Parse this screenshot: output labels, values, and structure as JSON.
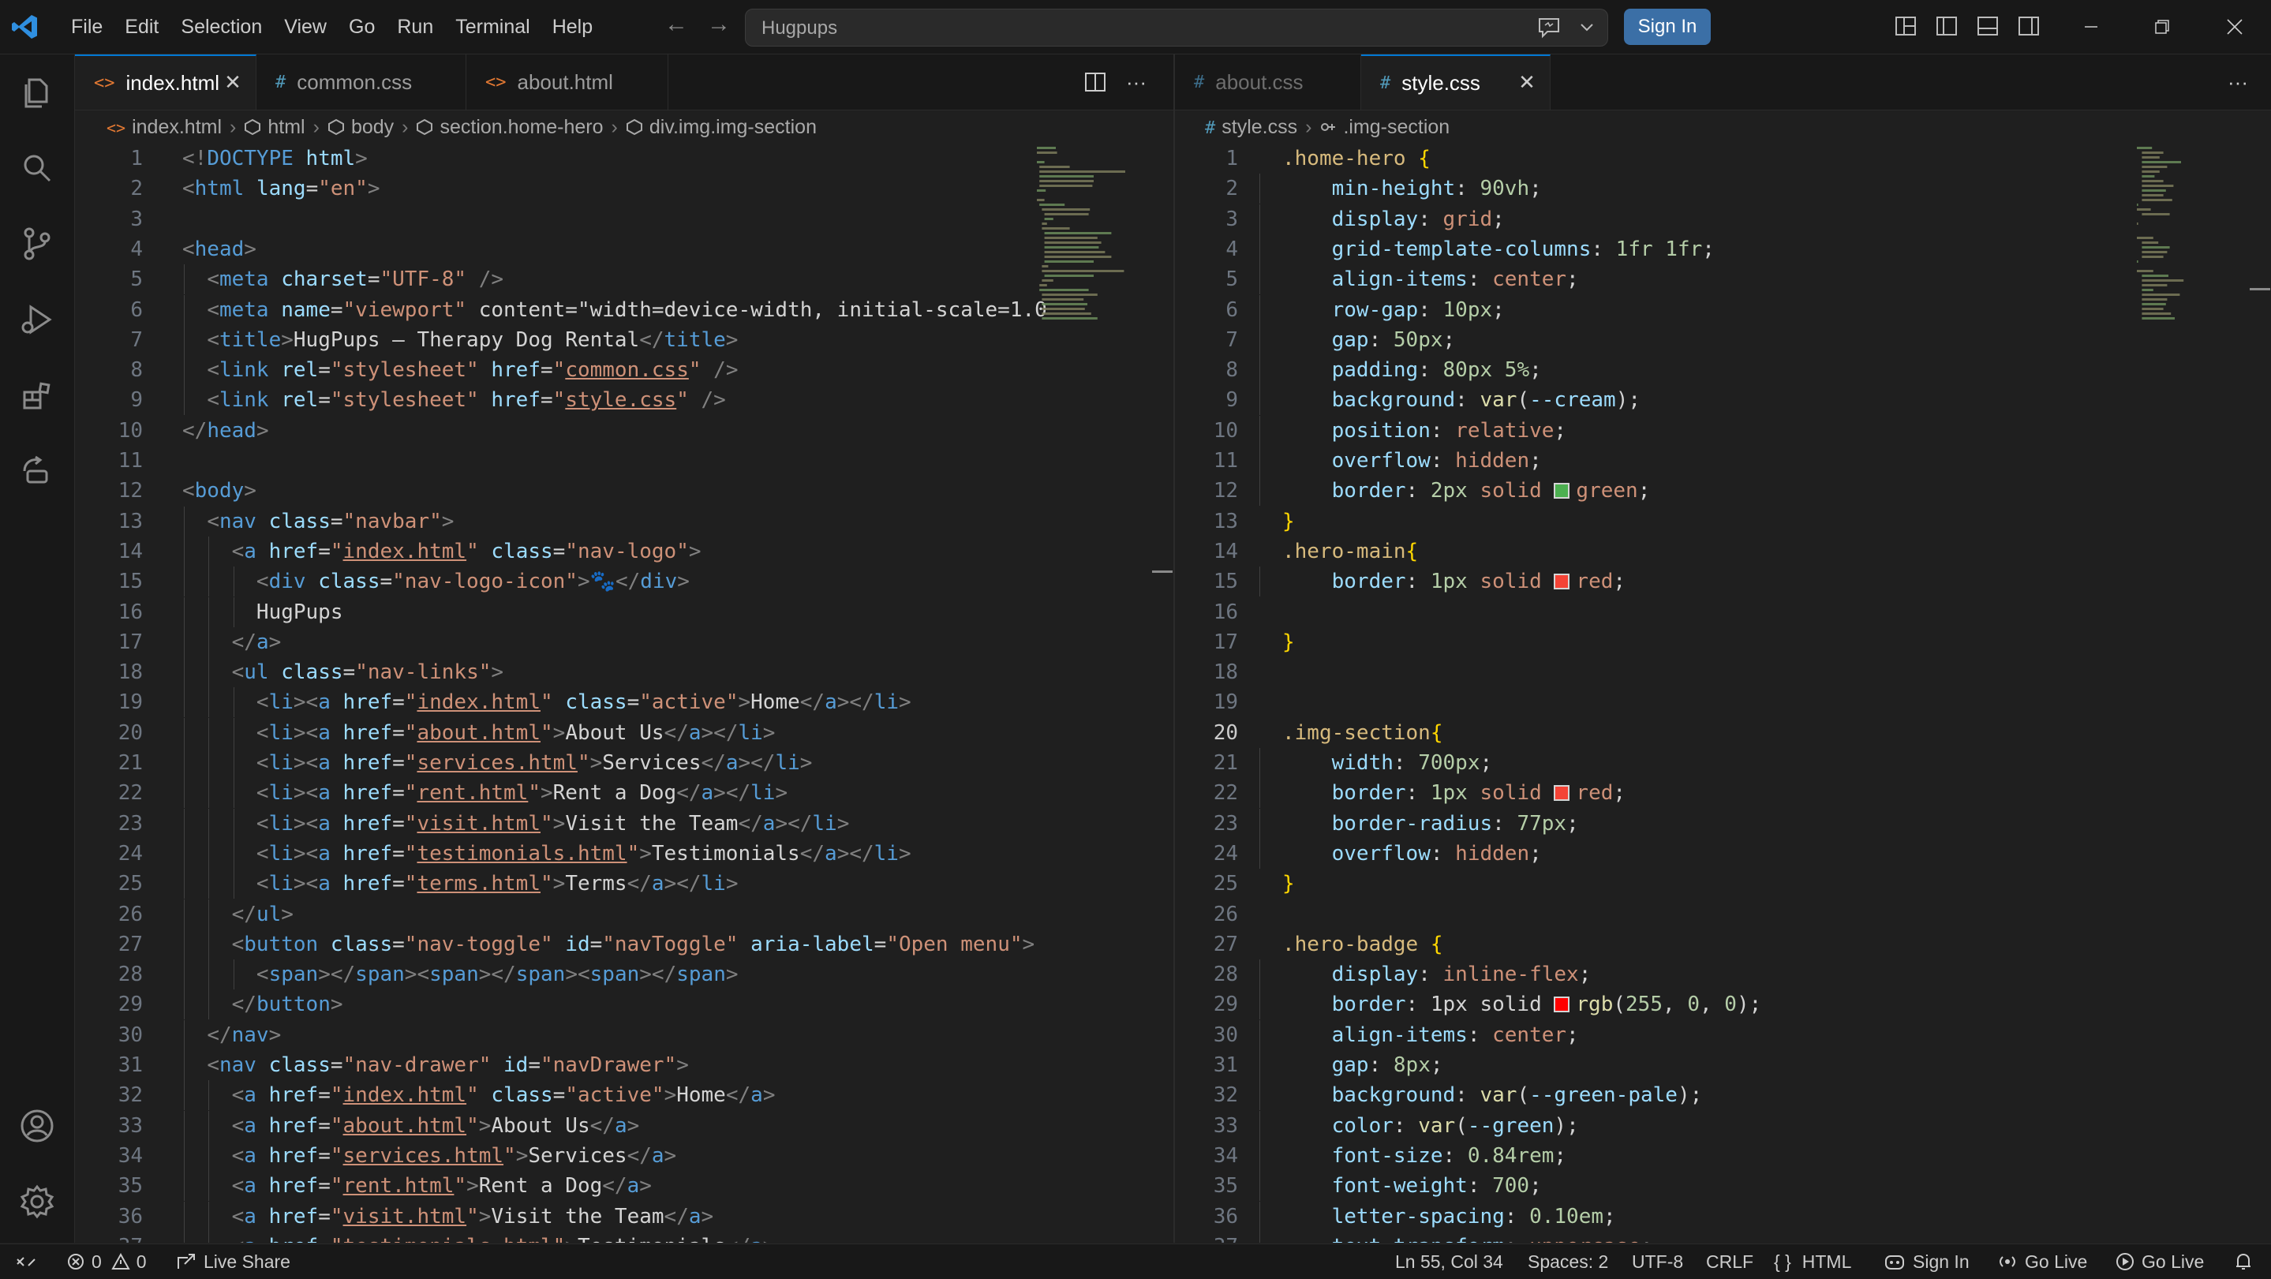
{
  "titlebar": {
    "menu": [
      "File",
      "Edit",
      "Selection",
      "View",
      "Go",
      "Run",
      "Terminal",
      "Help"
    ],
    "search_text": "Hugpups",
    "sign_in_label": "Sign In"
  },
  "activity_icons": [
    "explorer-icon",
    "search-icon",
    "source-control-icon",
    "run-debug-icon",
    "extensions-icon",
    "remote-explorer-icon",
    "accounts-icon",
    "settings-gear-icon"
  ],
  "left": {
    "tabs": [
      {
        "label": "index.html",
        "icon": "<>",
        "active": true
      },
      {
        "label": "common.css",
        "icon": "#",
        "active": false
      },
      {
        "label": "about.html",
        "icon": "<>",
        "active": false
      }
    ],
    "breadcrumb": [
      "index.html",
      "html",
      "body",
      "section.home-hero",
      "div.img.img-section"
    ],
    "lines": [
      {
        "n": "1",
        "text": "<!DOCTYPE html>"
      },
      {
        "n": "2",
        "text": "<html lang=\"en\">"
      },
      {
        "n": "3",
        "text": ""
      },
      {
        "n": "4",
        "text": "<head>"
      },
      {
        "n": "5",
        "text": "  <meta charset=\"UTF-8\" />"
      },
      {
        "n": "6",
        "text": "  <meta name=\"viewport\" content=\"width=device-width, initial-scale=1.0"
      },
      {
        "n": "7",
        "text": "  <title>HugPups — Therapy Dog Rental</title>"
      },
      {
        "n": "8",
        "text": "  <link rel=\"stylesheet\" href=\"common.css\" />"
      },
      {
        "n": "9",
        "text": "  <link rel=\"stylesheet\" href=\"style.css\" />"
      },
      {
        "n": "10",
        "text": "</head>"
      },
      {
        "n": "11",
        "text": ""
      },
      {
        "n": "12",
        "text": "<body>"
      },
      {
        "n": "13",
        "text": "  <nav class=\"navbar\">"
      },
      {
        "n": "14",
        "text": "    <a href=\"index.html\" class=\"nav-logo\">"
      },
      {
        "n": "15",
        "text": "      <div class=\"nav-logo-icon\">🐾</div>"
      },
      {
        "n": "16",
        "text": "      HugPups"
      },
      {
        "n": "17",
        "text": "    </a>"
      },
      {
        "n": "18",
        "text": "    <ul class=\"nav-links\">"
      },
      {
        "n": "19",
        "text": "      <li><a href=\"index.html\" class=\"active\">Home</a></li>"
      },
      {
        "n": "20",
        "text": "      <li><a href=\"about.html\">About Us</a></li>"
      },
      {
        "n": "21",
        "text": "      <li><a href=\"services.html\">Services</a></li>"
      },
      {
        "n": "22",
        "text": "      <li><a href=\"rent.html\">Rent a Dog</a></li>"
      },
      {
        "n": "23",
        "text": "      <li><a href=\"visit.html\">Visit the Team</a></li>"
      },
      {
        "n": "24",
        "text": "      <li><a href=\"testimonials.html\">Testimonials</a></li>"
      },
      {
        "n": "25",
        "text": "      <li><a href=\"terms.html\">Terms</a></li>"
      },
      {
        "n": "26",
        "text": "    </ul>"
      },
      {
        "n": "27",
        "text": "    <button class=\"nav-toggle\" id=\"navToggle\" aria-label=\"Open menu\">"
      },
      {
        "n": "28",
        "text": "      <span></span><span></span><span></span>"
      },
      {
        "n": "29",
        "text": "    </button>"
      },
      {
        "n": "30",
        "text": "  </nav>"
      },
      {
        "n": "31",
        "text": "  <nav class=\"nav-drawer\" id=\"navDrawer\">"
      },
      {
        "n": "32",
        "text": "    <a href=\"index.html\" class=\"active\">Home</a>"
      },
      {
        "n": "33",
        "text": "    <a href=\"about.html\">About Us</a>"
      },
      {
        "n": "34",
        "text": "    <a href=\"services.html\">Services</a>"
      },
      {
        "n": "35",
        "text": "    <a href=\"rent.html\">Rent a Dog</a>"
      },
      {
        "n": "36",
        "text": "    <a href=\"visit.html\">Visit the Team</a>"
      },
      {
        "n": "37",
        "text": "    <a href=\"testimonials.html\">Testimonials</a>"
      }
    ]
  },
  "right": {
    "tabs": [
      {
        "label": "about.css",
        "icon": "#",
        "active": false
      },
      {
        "label": "style.css",
        "icon": "#",
        "active": true
      }
    ],
    "breadcrumb": [
      "style.css",
      ".img-section"
    ],
    "current_line": "20",
    "lines": [
      {
        "n": "1",
        "text": ".home-hero {"
      },
      {
        "n": "2",
        "text": "    min-height: 90vh;"
      },
      {
        "n": "3",
        "text": "    display: grid;"
      },
      {
        "n": "4",
        "text": "    grid-template-columns: 1fr 1fr;"
      },
      {
        "n": "5",
        "text": "    align-items: center;"
      },
      {
        "n": "6",
        "text": "    row-gap: 10px;"
      },
      {
        "n": "7",
        "text": "    gap: 50px;"
      },
      {
        "n": "8",
        "text": "    padding: 80px 5%;"
      },
      {
        "n": "9",
        "text": "    background: var(--cream);"
      },
      {
        "n": "10",
        "text": "    position: relative;"
      },
      {
        "n": "11",
        "text": "    overflow: hidden;"
      },
      {
        "n": "12",
        "text": "    border: 2px solid green;",
        "swatch": "#4caf50"
      },
      {
        "n": "13",
        "text": "}"
      },
      {
        "n": "14",
        "text": ".hero-main{"
      },
      {
        "n": "15",
        "text": "    border: 1px solid red;",
        "swatch": "#f44336"
      },
      {
        "n": "16",
        "text": ""
      },
      {
        "n": "17",
        "text": "}"
      },
      {
        "n": "18",
        "text": ""
      },
      {
        "n": "19",
        "text": ""
      },
      {
        "n": "20",
        "text": ".img-section{"
      },
      {
        "n": "21",
        "text": "    width: 700px;"
      },
      {
        "n": "22",
        "text": "    border: 1px solid red;",
        "swatch": "#f44336"
      },
      {
        "n": "23",
        "text": "    border-radius: 77px;"
      },
      {
        "n": "24",
        "text": "    overflow: hidden;"
      },
      {
        "n": "25",
        "text": "}"
      },
      {
        "n": "26",
        "text": ""
      },
      {
        "n": "27",
        "text": ".hero-badge {"
      },
      {
        "n": "28",
        "text": "    display: inline-flex;"
      },
      {
        "n": "29",
        "text": "    border: 1px solid rgb(255, 0, 0);",
        "swatch": "#ff0000"
      },
      {
        "n": "30",
        "text": "    align-items: center;"
      },
      {
        "n": "31",
        "text": "    gap: 8px;"
      },
      {
        "n": "32",
        "text": "    background: var(--green-pale);"
      },
      {
        "n": "33",
        "text": "    color: var(--green);"
      },
      {
        "n": "34",
        "text": "    font-size: 0.84rem;"
      },
      {
        "n": "35",
        "text": "    font-weight: 700;"
      },
      {
        "n": "36",
        "text": "    letter-spacing: 0.10em;"
      },
      {
        "n": "37",
        "text": "    text-transform: uppercase;"
      }
    ]
  },
  "statusbar": {
    "errors": "0",
    "warnings": "0",
    "live_share": "Live Share",
    "position": "Ln 55, Col 34",
    "spaces": "Spaces: 2",
    "encoding": "UTF-8",
    "eol": "CRLF",
    "language": "HTML",
    "sign_in": "Sign In",
    "go_live_1": "Go Live",
    "go_live_2": "Go Live"
  },
  "colors": {
    "accent": "#0078d4",
    "signin_button": "#3b6fa6",
    "editor_bg": "#1f1f1f"
  }
}
